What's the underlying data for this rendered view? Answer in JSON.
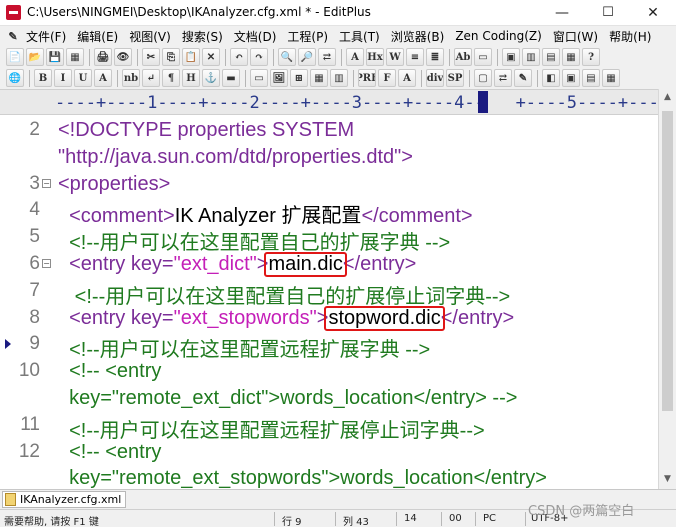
{
  "window": {
    "title": "C:\\Users\\NINGMEI\\Desktop\\IKAnalyzer.cfg.xml * - EditPlus",
    "minimize": "—",
    "maximize": "☐",
    "close": "✕"
  },
  "menu": [
    "文件(F)",
    "编辑(E)",
    "视图(V)",
    "搜索(S)",
    "文档(D)",
    "工程(P)",
    "工具(T)",
    "浏览器(B)",
    "Zen Coding(Z)",
    "窗口(W)",
    "帮助(H)"
  ],
  "toolbar1": [
    "📄",
    "📂",
    "💾",
    "▦",
    "🖨",
    "👁",
    "✂",
    "⎘",
    "📋",
    "✕",
    "↶",
    "↷",
    "🔍",
    "🔎",
    "⇄",
    "A",
    "Hx",
    "W",
    "≡",
    "≣",
    "Ab",
    "▭",
    "▣",
    "▥",
    "▤",
    "▦",
    "?"
  ],
  "toolbar2": [
    "🌐",
    "B",
    "I",
    "U",
    "A",
    "nb",
    "↵",
    "¶",
    "H",
    "⚓",
    "▬",
    "▭",
    "🖼",
    "⊞",
    "▦",
    "▥",
    "PRE",
    "F",
    "A",
    "div",
    "SP",
    "▢",
    "⇄",
    "✎",
    "◧",
    "▣",
    "▤",
    "▦"
  ],
  "ruler": {
    "text": "----+----1----+----2----+----3----+----4--   +----5----+----6"
  },
  "editor": {
    "lines": [
      {
        "num": "2",
        "fold": "",
        "bookmark": false,
        "segments": [
          {
            "t": "<!DOCTYPE properties SYSTEM",
            "c": "pur"
          }
        ]
      },
      {
        "num": "",
        "fold": "",
        "bookmark": false,
        "segments": [
          {
            "t": "\"http://java.sun.com/dtd/properties.dtd\">",
            "c": "pur"
          }
        ]
      },
      {
        "num": "3",
        "fold": "⊟",
        "bookmark": false,
        "segments": [
          {
            "t": "<properties>",
            "c": "pur"
          }
        ]
      },
      {
        "num": "4",
        "fold": "",
        "bookmark": false,
        "segments": [
          {
            "t": "  <comment>",
            "c": "pur"
          },
          {
            "t": "IK Analyzer 扩展配置",
            "c": "blk"
          },
          {
            "t": "</comment>",
            "c": "pur"
          }
        ]
      },
      {
        "num": "5",
        "fold": "",
        "bookmark": false,
        "segments": [
          {
            "t": "  <!--用户可以在这里配置自己的扩展字典 -->",
            "c": "grn"
          }
        ]
      },
      {
        "num": "6",
        "fold": "⊟",
        "bookmark": false,
        "segments": [
          {
            "t": "  <entry key=",
            "c": "pur"
          },
          {
            "t": "\"ext_dict\"",
            "c": "mag"
          },
          {
            "t": ">",
            "c": "pur"
          },
          {
            "t": "main.dic",
            "c": "blk"
          },
          {
            "t": "</entry>",
            "c": "pur"
          }
        ]
      },
      {
        "num": "7",
        "fold": "",
        "bookmark": false,
        "segments": [
          {
            "t": "   <!--用户可以在这里配置自己的扩展停止词字典-->",
            "c": "grn"
          }
        ]
      },
      {
        "num": "8",
        "fold": "",
        "bookmark": false,
        "segments": [
          {
            "t": "  <entry key=",
            "c": "pur"
          },
          {
            "t": "\"ext_stopwords\"",
            "c": "mag"
          },
          {
            "t": ">",
            "c": "pur"
          },
          {
            "t": "stopword.dic",
            "c": "blk"
          },
          {
            "t": "</entry>",
            "c": "pur"
          }
        ]
      },
      {
        "num": "9",
        "fold": "",
        "bookmark": true,
        "segments": [
          {
            "t": "  <!--用户可以在这里配置远程扩展字典 -->",
            "c": "grn"
          }
        ]
      },
      {
        "num": "10",
        "fold": "",
        "bookmark": false,
        "segments": [
          {
            "t": "  <!-- <entry",
            "c": "grn"
          }
        ]
      },
      {
        "num": "",
        "fold": "",
        "bookmark": false,
        "segments": [
          {
            "t": "  key=\"remote_ext_dict\">words_location</entry> -->",
            "c": "grn"
          }
        ]
      },
      {
        "num": "11",
        "fold": "",
        "bookmark": false,
        "segments": [
          {
            "t": "  <!--用户可以在这里配置远程扩展停止词字典-->",
            "c": "grn"
          }
        ]
      },
      {
        "num": "12",
        "fold": "",
        "bookmark": false,
        "segments": [
          {
            "t": "  <!-- <entry",
            "c": "grn"
          }
        ]
      },
      {
        "num": "",
        "fold": "",
        "bookmark": false,
        "segments": [
          {
            "t": "  key=\"remote_ext_stopwords\">words_location</entry>",
            "c": "grn"
          }
        ]
      }
    ]
  },
  "tabs": [
    {
      "label": "IKAnalyzer.cfg.xml"
    }
  ],
  "status": {
    "help": "需要帮助, 请按 F1 键",
    "line": "行 9",
    "col": "列 43",
    "num": "14",
    "value": "00",
    "mode": "PC",
    "encoding": "UTF-8+"
  },
  "watermark": "CSDN @两篇空白"
}
